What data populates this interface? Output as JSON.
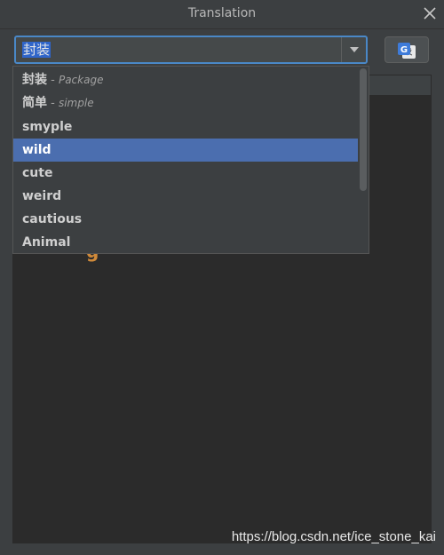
{
  "window": {
    "title": "Translation"
  },
  "search": {
    "value": "封装",
    "placeholder": ""
  },
  "dropdown": {
    "items": [
      {
        "word": "封装",
        "separator": " - ",
        "translation": "Package"
      },
      {
        "word": "简单",
        "separator": " - ",
        "translation": "simple"
      },
      {
        "word": "smyple",
        "separator": "",
        "translation": ""
      },
      {
        "word": "wild",
        "separator": "",
        "translation": ""
      },
      {
        "word": "cute",
        "separator": "",
        "translation": ""
      },
      {
        "word": "weird",
        "separator": "",
        "translation": ""
      },
      {
        "word": "cautious",
        "separator": "",
        "translation": ""
      },
      {
        "word": "Animal",
        "separator": "",
        "translation": ""
      }
    ],
    "selected_index": 3
  },
  "watermark": {
    "text": "https://blog.csdn.net/ice_stone_kai"
  },
  "icons": {
    "close": "close-icon",
    "dropdown_arrow": "chevron-down-icon",
    "translate": "google-translate-icon"
  },
  "colors": {
    "accent": "#4a88c7",
    "selection": "#4b6eaf",
    "background": "#3c3f41",
    "content_bg": "#2b2b2b"
  }
}
